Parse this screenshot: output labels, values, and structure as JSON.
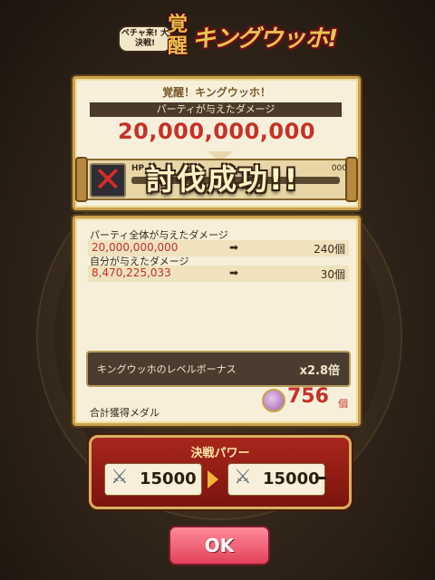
{
  "header": {
    "logo_sub": "ペチャ来! 大決戦!",
    "logo_kaku": "覚醒",
    "logo_main": "キングウッホ!"
  },
  "result": {
    "title": "覚醒！キングウッホ！",
    "party_damage_label": "パーティが与えたダメージ",
    "party_damage_value": "20,000,000,000",
    "hp_label": "HP",
    "hp_tail": "000",
    "banner_text": "討伐成功!!"
  },
  "rewards": {
    "row1_label": "パーティ全体が与えたダメージ",
    "row1_value": "20,000,000,000",
    "row1_count": "240個",
    "row2_label": "自分が与えたダメージ",
    "row2_value": "8,470,225,033",
    "row2_count": "30個",
    "bonus_label": "キングウッホのレベルボーナス",
    "bonus_value": "x2.8倍",
    "total_label": "合計獲得メダル",
    "total_value": "756",
    "total_unit": "個"
  },
  "power": {
    "title": "決戦パワー",
    "before": "15000",
    "after": "15000"
  },
  "ok_label": "OK",
  "icons": {
    "arrow": "➡",
    "sword": "⚔"
  }
}
